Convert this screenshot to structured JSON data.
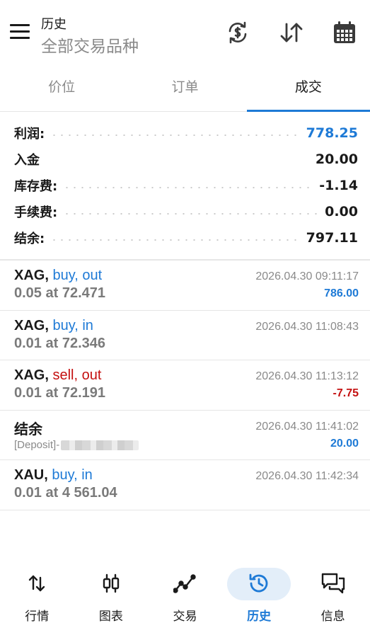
{
  "header": {
    "title": "历史",
    "subtitle": "全部交易品种",
    "icons": [
      "menu-icon",
      "currency-swap-icon",
      "sort-icon",
      "calendar-icon"
    ]
  },
  "tabs": [
    {
      "label": "价位",
      "active": false
    },
    {
      "label": "订单",
      "active": false
    },
    {
      "label": "成交",
      "active": true
    }
  ],
  "summary": [
    {
      "label": "利润:",
      "value": "778.25",
      "color": "#1e7ad6"
    },
    {
      "label": "入金",
      "value": "20.00",
      "color": "#1a1a1a"
    },
    {
      "label": "库存费:",
      "value": "-1.14",
      "color": "#1a1a1a"
    },
    {
      "label": "手续费:",
      "value": "0.00",
      "color": "#1a1a1a"
    },
    {
      "label": "结余:",
      "value": "797.11",
      "color": "#1a1a1a"
    }
  ],
  "deals": [
    {
      "symbol": "XAG,",
      "side": " buy, out",
      "side_color": "blue",
      "volume": "0.05 at 72.471",
      "time": "2026.04.30 09:11:17",
      "profit": "786.00",
      "profit_color": "blue"
    },
    {
      "symbol": "XAG,",
      "side": " buy, in",
      "side_color": "blue",
      "volume": "0.01 at 72.346",
      "time": "2026.04.30 11:08:43",
      "profit": "",
      "profit_color": "blue"
    },
    {
      "symbol": "XAG,",
      "side": " sell, out",
      "side_color": "red",
      "volume": "0.01 at 72.191",
      "time": "2026.04.30 11:13:12",
      "profit": "-7.75",
      "profit_color": "red"
    },
    {
      "symbol": "结余",
      "side": "",
      "side_color": "blue",
      "comment": "[Deposit]-",
      "time": "2026.04.30 11:41:02",
      "profit": "20.00",
      "profit_color": "blue"
    },
    {
      "symbol": "XAU,",
      "side": " buy, in",
      "side_color": "blue",
      "volume": "0.01 at 4 561.04",
      "time": "2026.04.30 11:42:34",
      "profit": "",
      "profit_color": "blue"
    }
  ],
  "nav": [
    {
      "label": "行情",
      "icon": "quotes-arrows-icon",
      "active": false
    },
    {
      "label": "图表",
      "icon": "candlestick-chart-icon",
      "active": false
    },
    {
      "label": "交易",
      "icon": "trade-line-icon",
      "active": false
    },
    {
      "label": "历史",
      "icon": "history-clock-icon",
      "active": true
    },
    {
      "label": "信息",
      "icon": "messages-icon",
      "active": false
    }
  ],
  "colors": {
    "accent": "#1e7ad6",
    "loss": "#c41010",
    "muted": "#8a8a8a"
  }
}
